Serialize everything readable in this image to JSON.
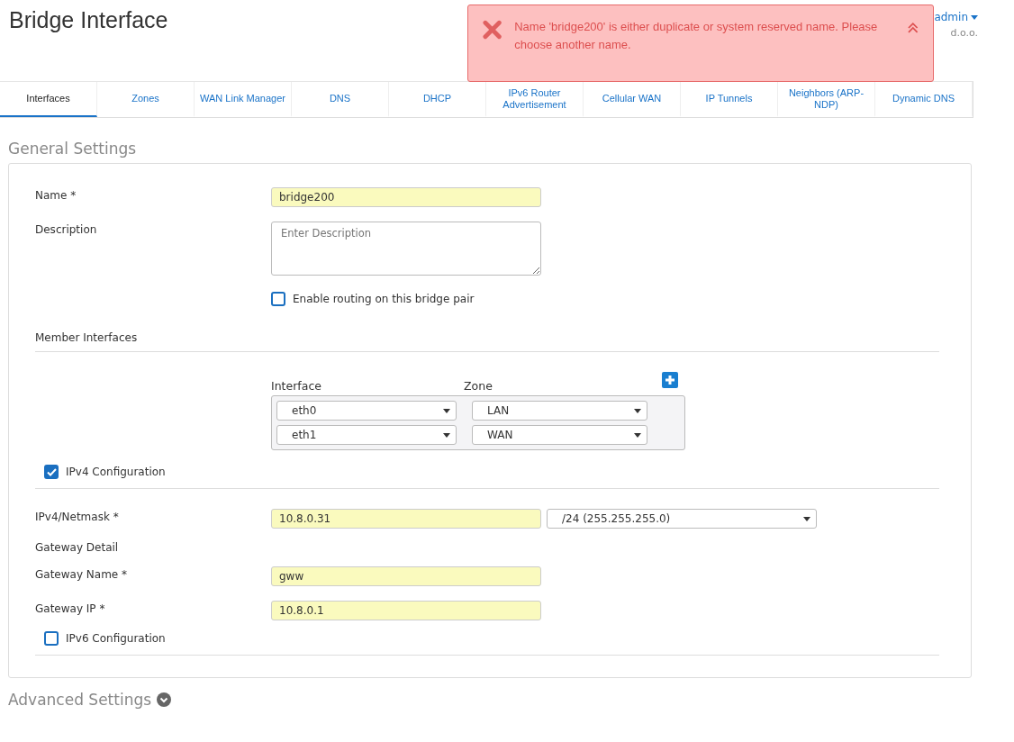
{
  "page_title": "Bridge Interface",
  "header": {
    "user": "admin",
    "company": "d.o.o."
  },
  "alert": {
    "message": "Name 'bridge200' is either duplicate or system reserved name. Please choose another name."
  },
  "tabs": [
    {
      "label": "Interfaces",
      "selected": true
    },
    {
      "label": "Zones",
      "selected": false
    },
    {
      "label": "WAN Link Manager",
      "selected": false
    },
    {
      "label": "DNS",
      "selected": false
    },
    {
      "label": "DHCP",
      "selected": false
    },
    {
      "label": "IPv6 Router Advertisement",
      "selected": false
    },
    {
      "label": "Cellular WAN",
      "selected": false
    },
    {
      "label": "IP Tunnels",
      "selected": false
    },
    {
      "label": "Neighbors (ARP-NDP)",
      "selected": false
    },
    {
      "label": "Dynamic DNS",
      "selected": false
    }
  ],
  "general_settings": {
    "title": "General Settings",
    "name": {
      "label": "Name *",
      "value": "bridge200"
    },
    "description": {
      "label": "Description",
      "placeholder": "Enter Description"
    },
    "routing": {
      "label": "Enable routing on this bridge pair",
      "checked": false
    },
    "member_interfaces": {
      "title": "Member Interfaces",
      "columns": [
        "Interface",
        "Zone"
      ],
      "rows": [
        {
          "interface": "eth0",
          "zone": "LAN"
        },
        {
          "interface": "eth1",
          "zone": "WAN"
        }
      ]
    },
    "ipv4": {
      "label": "IPv4 Configuration",
      "checked": true,
      "netmask_label": "IPv4/Netmask *",
      "ip": "10.8.0.31",
      "mask": "/24 (255.255.255.0)",
      "gateway_title": "Gateway Detail",
      "gateway_name": {
        "label": "Gateway Name  *",
        "value": "gww"
      },
      "gateway_ip": {
        "label": "Gateway IP  *",
        "value": "10.8.0.1"
      }
    },
    "ipv6": {
      "label": "IPv6 Configuration",
      "checked": false
    }
  },
  "advanced_settings": {
    "title": "Advanced Settings"
  }
}
